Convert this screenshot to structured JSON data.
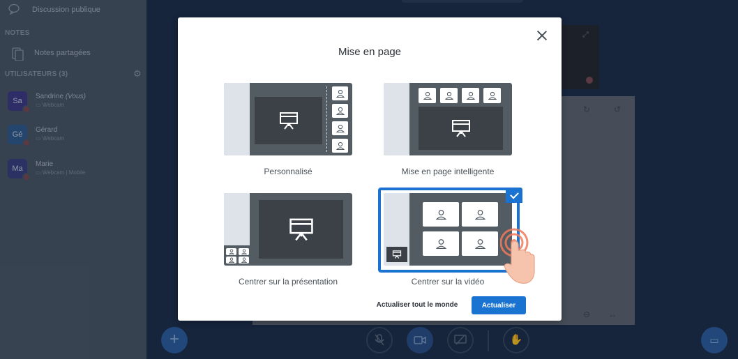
{
  "sidebar": {
    "public_chat": "Discussion publique",
    "notes_heading": "NOTES",
    "shared_notes": "Notes partagées",
    "users_heading": "UTILISATEURS (3)",
    "users": [
      {
        "initials": "Sa",
        "name": "Sandrine",
        "you_tag": "(Vous)",
        "status": "Webcam",
        "color": "#3f3a86"
      },
      {
        "initials": "Gé",
        "name": "Gérard",
        "you_tag": "",
        "status": "Webcam",
        "color": "#2f5a8e"
      },
      {
        "initials": "Ma",
        "name": "Marie",
        "you_tag": "",
        "status": "Webcam | Mobile",
        "color": "#3a3f7d"
      }
    ]
  },
  "modal": {
    "title": "Mise en page",
    "options": [
      {
        "label": "Personnalisé",
        "selected": false
      },
      {
        "label": "Mise en page intelligente",
        "selected": false
      },
      {
        "label": "Centrer sur la présentation",
        "selected": false
      },
      {
        "label": "Centrer sur la vidéo",
        "selected": true
      }
    ],
    "update_everyone_label": "Actualiser tout le monde",
    "update_label": "Actualiser"
  },
  "colors": {
    "accent": "#1a72d1",
    "preview_bg": "#535b63",
    "presentation_bg": "#3c4147"
  },
  "icons": {
    "public_chat": "chat-bubbles-icon",
    "shared_notes": "notes-icon",
    "settings": "gear-icon",
    "close": "close-icon",
    "presentation": "presentation-board-icon",
    "user": "user-icon",
    "selected": "checkmark-icon",
    "cursor": "tap-hand-cursor-icon"
  }
}
